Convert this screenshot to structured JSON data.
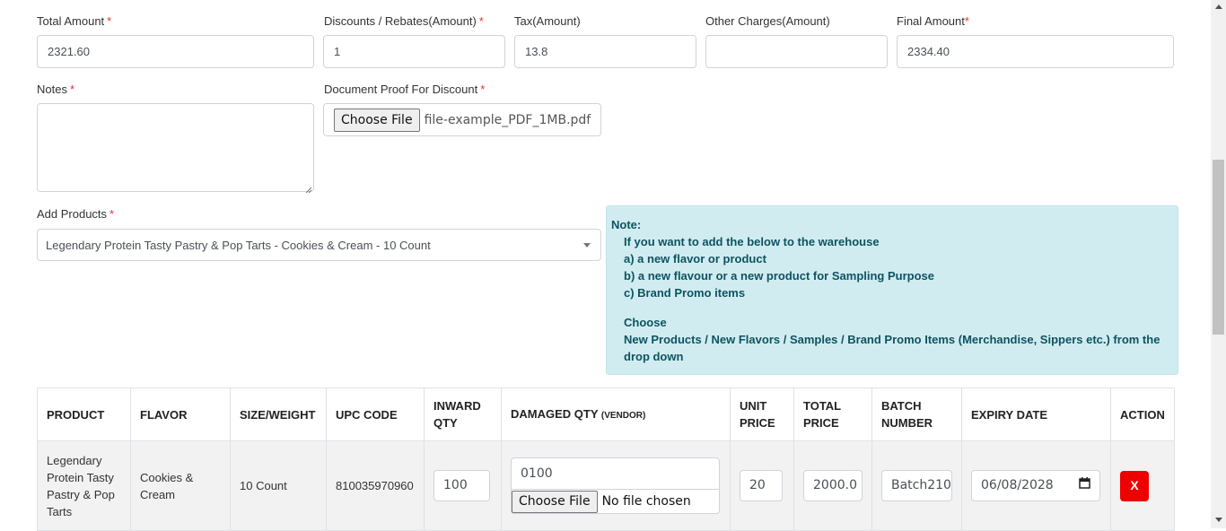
{
  "form": {
    "total_amount": {
      "label": "Total Amount",
      "required": "*",
      "value": "2321.60"
    },
    "discounts": {
      "label": "Discounts / Rebates(Amount)",
      "required": "*",
      "value": "1"
    },
    "tax": {
      "label": "Tax(Amount)",
      "value": "13.8"
    },
    "other_charges": {
      "label": "Other Charges(Amount)",
      "value": ""
    },
    "final_amount": {
      "label": "Final Amount",
      "required": "*",
      "value": "2334.40"
    },
    "notes": {
      "label": "Notes",
      "required": "*",
      "value": ""
    },
    "document_proof": {
      "label": "Document Proof For Discount",
      "required": "*",
      "button_label": "Choose File",
      "file_name": "file-example_PDF_1MB.pdf"
    },
    "add_products": {
      "label": "Add Products",
      "required": "*",
      "selected": "Legendary Protein Tasty Pastry & Pop Tarts - Cookies & Cream - 10 Count"
    }
  },
  "note": {
    "title": "Note:",
    "intro": "If you want to add the below to the warehouse",
    "items": [
      "a) a new flavor or product",
      "b) a new flavour or a new product for Sampling Purpose",
      "c) Brand Promo items"
    ],
    "choose_title": "Choose",
    "choose_text": "New Products / New Flavors / Samples / Brand Promo Items (Merchandise, Sippers etc.) from the drop down"
  },
  "table": {
    "headers": {
      "product": "PRODUCT",
      "flavor": "FLAVOR",
      "size": "SIZE/WEIGHT",
      "upc": "UPC CODE",
      "inward_qty": "INWARD QTY",
      "damaged_qty": "DAMAGED QTY",
      "damaged_qty_sub": "(VENDOR)",
      "unit_price": "UNIT PRICE",
      "total_price": "TOTAL PRICE",
      "batch": "BATCH NUMBER",
      "expiry": "EXPIRY DATE",
      "action": "ACTION"
    },
    "rows": [
      {
        "product": "Legendary Protein Tasty Pastry & Pop Tarts",
        "flavor": "Cookies & Cream",
        "size": "10 Count",
        "upc": "810035970960",
        "inward_qty": "100",
        "damaged_qty": "0100",
        "damaged_file_button": "Choose File",
        "damaged_file_name": "No file chosen",
        "unit_price": "20",
        "total_price": "2000.0",
        "batch": "Batch210",
        "expiry": "06/08/2028",
        "action": "X"
      }
    ]
  },
  "colors": {
    "required": "#e3342f",
    "note_bg": "#d1ecf1",
    "note_text": "#0c5460",
    "delete_button": "#ee0000"
  }
}
